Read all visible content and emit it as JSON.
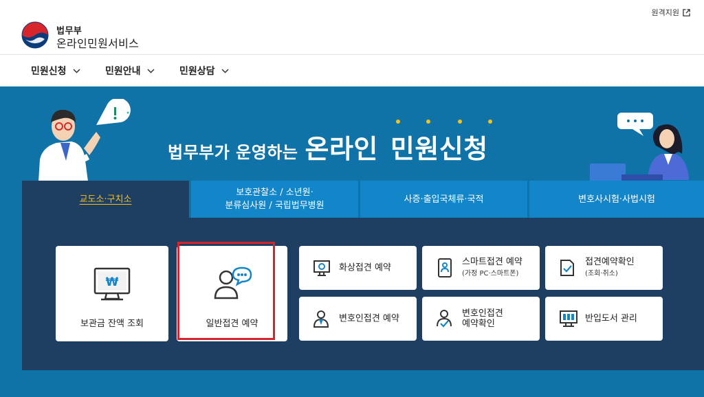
{
  "header": {
    "org_name": "법무부",
    "service_name": "온라인민원서비스",
    "remote_support": "원격지원"
  },
  "nav": {
    "items": [
      {
        "label": "민원신청"
      },
      {
        "label": "민원안내"
      },
      {
        "label": "민원상담"
      }
    ]
  },
  "hero": {
    "title_prefix": "법무부가 운영하는",
    "title_highlight": "온라인",
    "title_suffix": "민원신청"
  },
  "tabs": [
    {
      "label": "교도소·구치소",
      "active": true
    },
    {
      "line1": "보호관찰소 / 소년원·",
      "line2": "분류심사원 / 국립법무병원"
    },
    {
      "label": "사증·출입국체류·국적"
    },
    {
      "label": "변호사시험·사법시험"
    }
  ],
  "cards": {
    "deposit": {
      "label": "보관금 잔액 조회",
      "icon": "monitor-won-icon"
    },
    "general_visit": {
      "label": "일반접견 예약",
      "icon": "person-chat-icon"
    },
    "video_visit": {
      "label": "화상접견 예약",
      "icon": "video-monitor-icon"
    },
    "smart_visit": {
      "label": "스마트접견 예약",
      "sub": "(가정 PC·스마트폰)",
      "icon": "smartphone-person-icon"
    },
    "visit_check": {
      "label": "접견예약확인",
      "sub": "(조회·취소)",
      "icon": "document-check-icon"
    },
    "lawyer_visit": {
      "label": "변호인접견 예약",
      "icon": "lawyer-icon"
    },
    "lawyer_check": {
      "label1": "변호인접견",
      "label2": "예약확인",
      "icon": "lawyer-check-icon"
    },
    "book_mgmt": {
      "label": "반입도서 관리",
      "icon": "book-monitor-icon"
    }
  },
  "colors": {
    "hero_bg": "#0f73a8",
    "panel_bg": "#1e3e62",
    "tab_bg": "#1286c8",
    "accent_yellow": "#f4c21b",
    "highlight_red": "#d8232a"
  }
}
